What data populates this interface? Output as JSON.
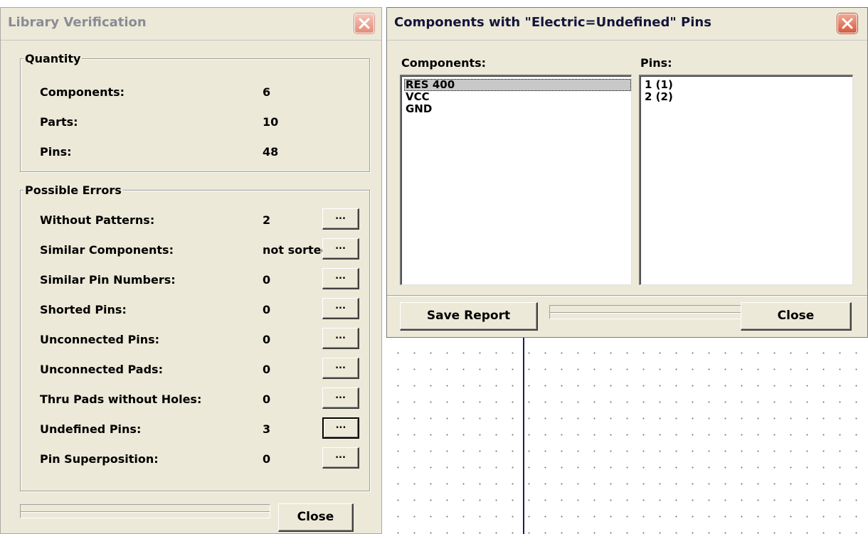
{
  "verification": {
    "title": "Library Verification",
    "quantity": {
      "label": "Quantity",
      "rows": [
        {
          "label": "Components:",
          "value": "6"
        },
        {
          "label": "Parts:",
          "value": "10"
        },
        {
          "label": "Pins:",
          "value": "48"
        }
      ]
    },
    "errors": {
      "label": "Possible Errors",
      "button_label": "...",
      "rows": [
        {
          "label": "Without Patterns:",
          "value": "2"
        },
        {
          "label": "Similar Components:",
          "value": "not sorted"
        },
        {
          "label": "Similar Pin Numbers:",
          "value": "0"
        },
        {
          "label": "Shorted Pins:",
          "value": "0"
        },
        {
          "label": "Unconnected Pins:",
          "value": "0"
        },
        {
          "label": "Unconnected Pads:",
          "value": "0"
        },
        {
          "label": "Thru Pads without Holes:",
          "value": "0"
        },
        {
          "label": "Undefined Pins:",
          "value": "3"
        },
        {
          "label": "Pin Superposition:",
          "value": "0"
        }
      ]
    },
    "close_label": "Close"
  },
  "undefined_pins": {
    "title": "Components with \"Electric=Undefined\" Pins",
    "components_label": "Components:",
    "pins_label": "Pins:",
    "components": [
      "RES 400",
      "VCC",
      "GND"
    ],
    "selected_component": "RES 400",
    "pins": [
      "1 (1)",
      "2 (2)"
    ],
    "save_label": "Save Report",
    "close_label": "Close"
  },
  "icons": {
    "close": "close-x-icon"
  }
}
